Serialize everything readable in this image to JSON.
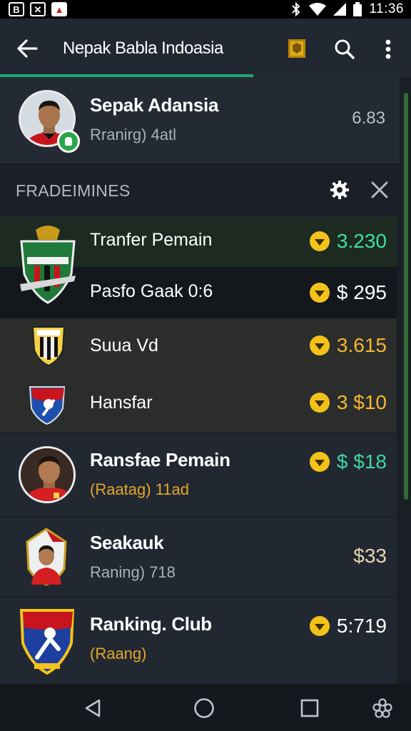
{
  "status_bar": {
    "time": "11:36",
    "left_icons": [
      "notification-b-icon",
      "notification-x-icon",
      "notification-red-icon"
    ],
    "right_icons": [
      "bluetooth-icon",
      "wifi-icon",
      "signal-icon",
      "battery-icon"
    ],
    "left_glyphs": [
      "B",
      "✕",
      "▲"
    ]
  },
  "app_bar": {
    "title": "Nepak Babla Indoasia"
  },
  "profile": {
    "name": "Sepak Adansia",
    "subtitle": "Rranirg) 4atl",
    "value": "6.83"
  },
  "section": {
    "title": "FRADEIMINES"
  },
  "transfers": [
    {
      "label": "Tranfer Pemain",
      "price": "3.230",
      "color": "#3fe09a"
    },
    {
      "label": "Pasfo Gaak 0:6",
      "price": "$ 295",
      "color": "#ffffff"
    },
    {
      "label": "Suua Vd",
      "price": "3.615",
      "color": "#f5b630"
    },
    {
      "label": "Hansfar",
      "price": "3 $10",
      "color": "#f5b630"
    }
  ],
  "cards": [
    {
      "title": "Ransfae Pemain",
      "subtitle": "(Raatag) 11ad",
      "price": "$ $18"
    },
    {
      "title": "Seakauk",
      "subtitle": "Raning) 718",
      "price": "$33"
    },
    {
      "title": "Ranking. Club",
      "subtitle": "(Raang)",
      "price": "5:719"
    }
  ],
  "colors": {
    "accent": "#1fa872",
    "coin": "#f2c21a",
    "background": "#1a1f26"
  }
}
